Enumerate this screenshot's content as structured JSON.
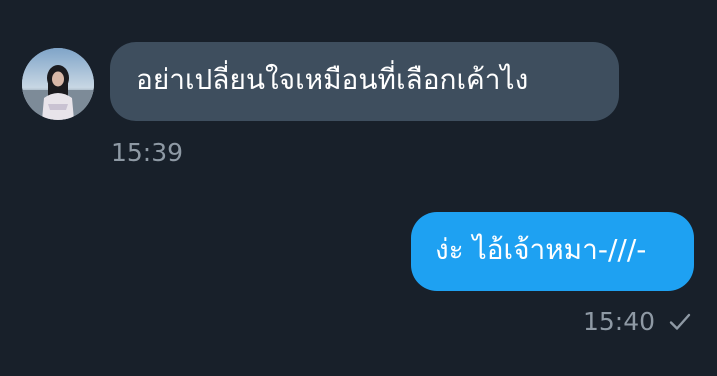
{
  "conversation": {
    "incoming": {
      "text": "อย่าเปลี่ยนใจเหมือนที่เลือกเค้าไง",
      "time": "15:39"
    },
    "outgoing": {
      "text": "ง่ะ ไอ้เจ้าหมา-///-",
      "time": "15:40",
      "status_icon": "check-icon"
    }
  },
  "colors": {
    "background": "#18202a",
    "incoming_bubble": "#3e4e5e",
    "outgoing_bubble": "#1ea1f2",
    "timestamp": "#8e99a4"
  }
}
